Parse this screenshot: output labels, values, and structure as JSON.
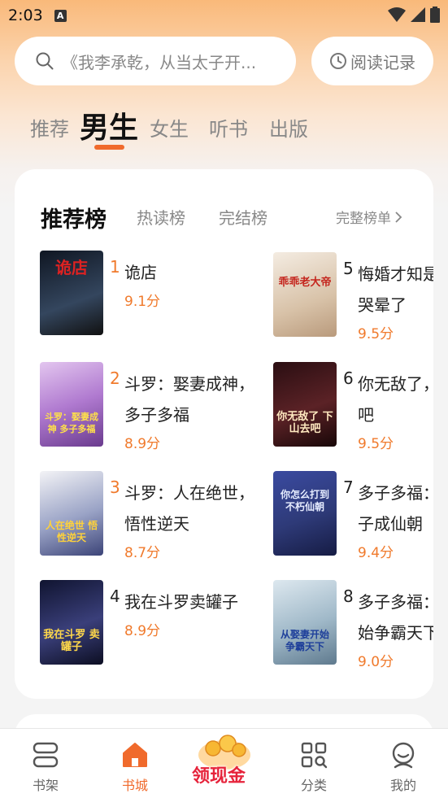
{
  "status_bar": {
    "time": "2:03"
  },
  "search": {
    "placeholder": "《我李承乾，从当太子开..."
  },
  "history": {
    "label": "阅读记录"
  },
  "categories": [
    {
      "label": "推荐",
      "active": false
    },
    {
      "label": "男生",
      "active": true
    },
    {
      "label": "女生",
      "active": false
    },
    {
      "label": "听书",
      "active": false
    },
    {
      "label": "出版",
      "active": false
    }
  ],
  "ranking": {
    "tabs": [
      {
        "label": "推荐榜",
        "active": true
      },
      {
        "label": "热读榜",
        "active": false
      },
      {
        "label": "完结榜",
        "active": false
      }
    ],
    "full_list_label": "完整榜单",
    "books": [
      {
        "rank": "1",
        "title": "诡店",
        "score": "9.1分",
        "cover_text": "诡店",
        "cover_color": "#1f2a3a",
        "rank_color": "#f07a2c"
      },
      {
        "rank": "2",
        "title": "斗罗：娶妻成神，多子多福",
        "score": "8.9分",
        "cover_text": "斗罗：娶妻成神 多子多福",
        "cover_color": "#b07ad0",
        "rank_color": "#f07a2c"
      },
      {
        "rank": "3",
        "title": "斗罗：人在绝世，悟性逆天",
        "score": "8.7分",
        "cover_text": "人在绝世 悟性逆天",
        "cover_color": "#6a7ab0",
        "rank_color": "#f07a2c"
      },
      {
        "rank": "4",
        "title": "我在斗罗卖罐子",
        "score": "8.9分",
        "cover_text": "我在斗罗 卖罐子",
        "cover_color": "#2a3160",
        "rank_color": "#222222"
      },
      {
        "rank": "5",
        "title": "悔婚才知是大帝，哭晕了",
        "score": "9.5分",
        "cover_text": "乖乖老大帝",
        "cover_color": "#e8d8c8",
        "rank_color": "#222222"
      },
      {
        "rank": "6",
        "title": "你无敌了，下山去吧",
        "score": "9.5分",
        "cover_text": "你无敌了 下山去吧",
        "cover_color": "#4a1e22",
        "rank_color": "#222222"
      },
      {
        "rank": "7",
        "title": "多子多福：娶妻生子成仙朝",
        "score": "9.4分",
        "cover_text": "你怎么打到 不朽仙朝",
        "cover_color": "#2e3a78",
        "rank_color": "#222222"
      },
      {
        "rank": "8",
        "title": "多子多福：娶妻开始争霸天下",
        "score": "9.0分",
        "cover_text": "从娶妻开始 争霸天下",
        "cover_color": "#9fb8c8",
        "rank_color": "#222222"
      }
    ]
  },
  "bottom_nav": [
    {
      "label": "书架",
      "active": false,
      "icon": "bookshelf-icon"
    },
    {
      "label": "书城",
      "active": true,
      "icon": "home-icon"
    },
    {
      "label": "领现金",
      "active": false,
      "icon": "cash-icon"
    },
    {
      "label": "分类",
      "active": false,
      "icon": "category-icon"
    },
    {
      "label": "我的",
      "active": false,
      "icon": "profile-icon"
    }
  ],
  "colors": {
    "accent": "#f06a2c",
    "score": "#f07a2c"
  }
}
